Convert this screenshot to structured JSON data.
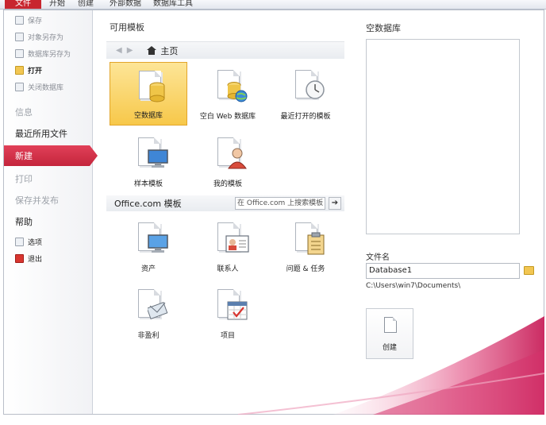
{
  "ribbon": {
    "tabs": [
      {
        "label": "文件",
        "active": true
      },
      {
        "label": "开始"
      },
      {
        "label": "创建"
      },
      {
        "label": "外部数据"
      },
      {
        "label": "数据库工具"
      }
    ]
  },
  "leftnav": {
    "commands": [
      {
        "label": "保存",
        "icon": "save-icon",
        "enabled": false
      },
      {
        "label": "对象另存为",
        "icon": "save-object-as-icon",
        "enabled": false
      },
      {
        "label": "数据库另存为",
        "icon": "save-database-as-icon",
        "enabled": false
      },
      {
        "label": "打开",
        "icon": "open-folder-icon",
        "enabled": true
      },
      {
        "label": "关闭数据库",
        "icon": "close-database-icon",
        "enabled": false
      }
    ],
    "sections": {
      "info": "信息",
      "recent": "最近所用文件",
      "new": "新建",
      "print": "打印",
      "save_publish": "保存并发布",
      "help": "帮助"
    },
    "options": "选项",
    "exit": "退出"
  },
  "center": {
    "available_templates": "可用模板",
    "breadcrumb_home": "主页",
    "templates": [
      {
        "label": "空数据库",
        "icon": "blank-database-icon",
        "selected": true
      },
      {
        "label": "空白 Web 数据库",
        "icon": "blank-web-database-icon"
      },
      {
        "label": "最近打开的模板",
        "icon": "recent-templates-icon"
      },
      {
        "label": "样本模板",
        "icon": "sample-templates-icon"
      },
      {
        "label": "我的模板",
        "icon": "my-templates-icon"
      }
    ],
    "office_title": "Office.com 模板",
    "search_placeholder": "在 Office.com 上搜索模板",
    "office_templates": [
      {
        "label": "资产",
        "icon": "assets-icon"
      },
      {
        "label": "联系人",
        "icon": "contacts-icon"
      },
      {
        "label": "问题 & 任务",
        "icon": "issues-tasks-icon"
      },
      {
        "label": "非盈利",
        "icon": "nonprofit-icon"
      },
      {
        "label": "项目",
        "icon": "projects-icon"
      }
    ]
  },
  "right": {
    "title": "空数据库",
    "filename_label": "文件名",
    "filename": "Database1",
    "path": "C:\\Users\\win7\\Documents\\",
    "create": "创建"
  },
  "colors": {
    "accent_red": "#c8262f",
    "selected_tile": "#f7c84a",
    "swoosh_pink": "#d6336c"
  }
}
